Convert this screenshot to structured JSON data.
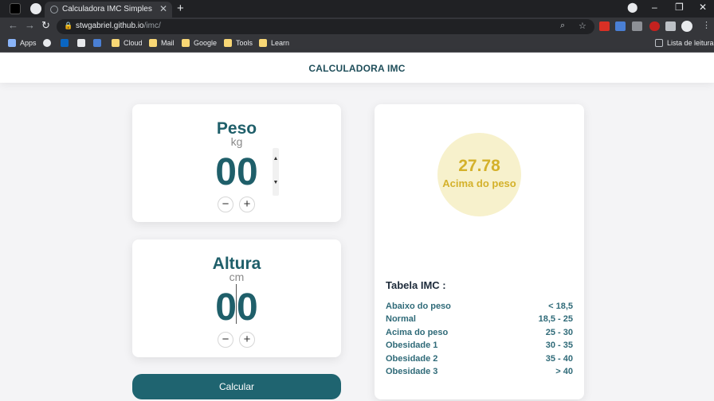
{
  "browser": {
    "tab_title": "Calculadora IMC Simples",
    "url_host": "stwgabriel.github.io",
    "url_path": "/imc/",
    "bookmarks": [
      "Apps",
      "Cloud",
      "Mail",
      "Google",
      "Tools",
      "Learn"
    ],
    "reading_list": "Lista de leitura"
  },
  "header": {
    "title": "CALCULADORA IMC"
  },
  "peso": {
    "title": "Peso",
    "unit": "kg",
    "value": "00",
    "minus": "−",
    "plus": "+"
  },
  "altura": {
    "title": "Altura",
    "unit": "cm",
    "value": "00",
    "minus": "−",
    "plus": "+"
  },
  "calc_button": "Calcular",
  "result": {
    "value": "27.78",
    "label": "Acima do peso",
    "color": "#d4b12b"
  },
  "table": {
    "title": "Tabela IMC :",
    "rows": [
      {
        "label": "Abaixo do peso",
        "range": "< 18,5"
      },
      {
        "label": "Normal",
        "range": "18,5 - 25"
      },
      {
        "label": "Acima do peso",
        "range": "25 - 30"
      },
      {
        "label": "Obesidade 1",
        "range": "30 - 35"
      },
      {
        "label": "Obesidade 2",
        "range": "35 - 40"
      },
      {
        "label": "Obesidade 3",
        "range": "> 40"
      }
    ]
  }
}
